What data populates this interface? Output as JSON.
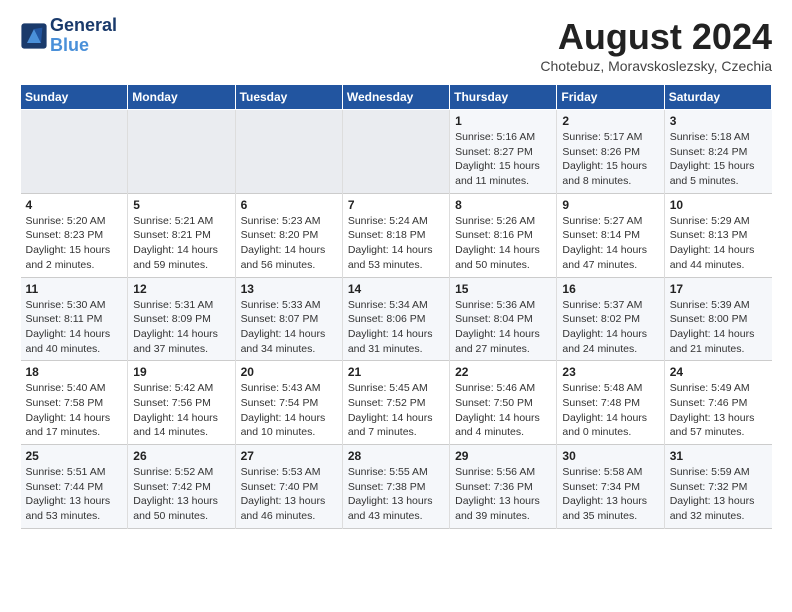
{
  "logo": {
    "line1": "General",
    "line2": "Blue"
  },
  "title": "August 2024",
  "subtitle": "Chotebuz, Moravskoslezsky, Czechia",
  "weekdays": [
    "Sunday",
    "Monday",
    "Tuesday",
    "Wednesday",
    "Thursday",
    "Friday",
    "Saturday"
  ],
  "weeks": [
    [
      {
        "day": "",
        "info": ""
      },
      {
        "day": "",
        "info": ""
      },
      {
        "day": "",
        "info": ""
      },
      {
        "day": "",
        "info": ""
      },
      {
        "day": "1",
        "info": "Sunrise: 5:16 AM\nSunset: 8:27 PM\nDaylight: 15 hours\nand 11 minutes."
      },
      {
        "day": "2",
        "info": "Sunrise: 5:17 AM\nSunset: 8:26 PM\nDaylight: 15 hours\nand 8 minutes."
      },
      {
        "day": "3",
        "info": "Sunrise: 5:18 AM\nSunset: 8:24 PM\nDaylight: 15 hours\nand 5 minutes."
      }
    ],
    [
      {
        "day": "4",
        "info": "Sunrise: 5:20 AM\nSunset: 8:23 PM\nDaylight: 15 hours\nand 2 minutes."
      },
      {
        "day": "5",
        "info": "Sunrise: 5:21 AM\nSunset: 8:21 PM\nDaylight: 14 hours\nand 59 minutes."
      },
      {
        "day": "6",
        "info": "Sunrise: 5:23 AM\nSunset: 8:20 PM\nDaylight: 14 hours\nand 56 minutes."
      },
      {
        "day": "7",
        "info": "Sunrise: 5:24 AM\nSunset: 8:18 PM\nDaylight: 14 hours\nand 53 minutes."
      },
      {
        "day": "8",
        "info": "Sunrise: 5:26 AM\nSunset: 8:16 PM\nDaylight: 14 hours\nand 50 minutes."
      },
      {
        "day": "9",
        "info": "Sunrise: 5:27 AM\nSunset: 8:14 PM\nDaylight: 14 hours\nand 47 minutes."
      },
      {
        "day": "10",
        "info": "Sunrise: 5:29 AM\nSunset: 8:13 PM\nDaylight: 14 hours\nand 44 minutes."
      }
    ],
    [
      {
        "day": "11",
        "info": "Sunrise: 5:30 AM\nSunset: 8:11 PM\nDaylight: 14 hours\nand 40 minutes."
      },
      {
        "day": "12",
        "info": "Sunrise: 5:31 AM\nSunset: 8:09 PM\nDaylight: 14 hours\nand 37 minutes."
      },
      {
        "day": "13",
        "info": "Sunrise: 5:33 AM\nSunset: 8:07 PM\nDaylight: 14 hours\nand 34 minutes."
      },
      {
        "day": "14",
        "info": "Sunrise: 5:34 AM\nSunset: 8:06 PM\nDaylight: 14 hours\nand 31 minutes."
      },
      {
        "day": "15",
        "info": "Sunrise: 5:36 AM\nSunset: 8:04 PM\nDaylight: 14 hours\nand 27 minutes."
      },
      {
        "day": "16",
        "info": "Sunrise: 5:37 AM\nSunset: 8:02 PM\nDaylight: 14 hours\nand 24 minutes."
      },
      {
        "day": "17",
        "info": "Sunrise: 5:39 AM\nSunset: 8:00 PM\nDaylight: 14 hours\nand 21 minutes."
      }
    ],
    [
      {
        "day": "18",
        "info": "Sunrise: 5:40 AM\nSunset: 7:58 PM\nDaylight: 14 hours\nand 17 minutes."
      },
      {
        "day": "19",
        "info": "Sunrise: 5:42 AM\nSunset: 7:56 PM\nDaylight: 14 hours\nand 14 minutes."
      },
      {
        "day": "20",
        "info": "Sunrise: 5:43 AM\nSunset: 7:54 PM\nDaylight: 14 hours\nand 10 minutes."
      },
      {
        "day": "21",
        "info": "Sunrise: 5:45 AM\nSunset: 7:52 PM\nDaylight: 14 hours\nand 7 minutes."
      },
      {
        "day": "22",
        "info": "Sunrise: 5:46 AM\nSunset: 7:50 PM\nDaylight: 14 hours\nand 4 minutes."
      },
      {
        "day": "23",
        "info": "Sunrise: 5:48 AM\nSunset: 7:48 PM\nDaylight: 14 hours\nand 0 minutes."
      },
      {
        "day": "24",
        "info": "Sunrise: 5:49 AM\nSunset: 7:46 PM\nDaylight: 13 hours\nand 57 minutes."
      }
    ],
    [
      {
        "day": "25",
        "info": "Sunrise: 5:51 AM\nSunset: 7:44 PM\nDaylight: 13 hours\nand 53 minutes."
      },
      {
        "day": "26",
        "info": "Sunrise: 5:52 AM\nSunset: 7:42 PM\nDaylight: 13 hours\nand 50 minutes."
      },
      {
        "day": "27",
        "info": "Sunrise: 5:53 AM\nSunset: 7:40 PM\nDaylight: 13 hours\nand 46 minutes."
      },
      {
        "day": "28",
        "info": "Sunrise: 5:55 AM\nSunset: 7:38 PM\nDaylight: 13 hours\nand 43 minutes."
      },
      {
        "day": "29",
        "info": "Sunrise: 5:56 AM\nSunset: 7:36 PM\nDaylight: 13 hours\nand 39 minutes."
      },
      {
        "day": "30",
        "info": "Sunrise: 5:58 AM\nSunset: 7:34 PM\nDaylight: 13 hours\nand 35 minutes."
      },
      {
        "day": "31",
        "info": "Sunrise: 5:59 AM\nSunset: 7:32 PM\nDaylight: 13 hours\nand 32 minutes."
      }
    ]
  ]
}
